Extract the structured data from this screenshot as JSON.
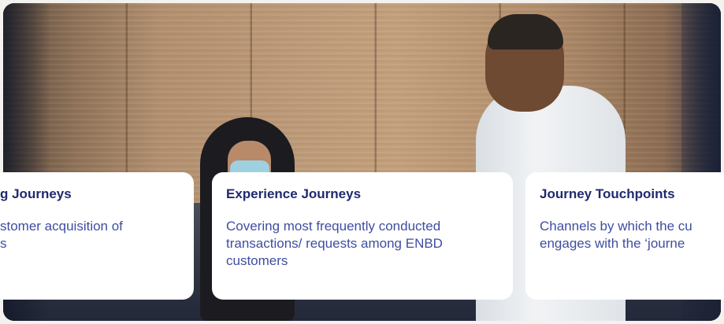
{
  "cards": [
    {
      "title": "g Journeys",
      "text": "stomer acquisition of\ns"
    },
    {
      "title": "Experience Journeys",
      "text": "Covering most frequently conducted transactions/ requests among ENBD customers"
    },
    {
      "title": "Journey Touchpoints",
      "text": "Channels by which the cu\nengages with the ‘journe"
    }
  ],
  "colors": {
    "title": "#1f2a6e",
    "body": "#3f4ea0",
    "card_bg": "#ffffff"
  }
}
